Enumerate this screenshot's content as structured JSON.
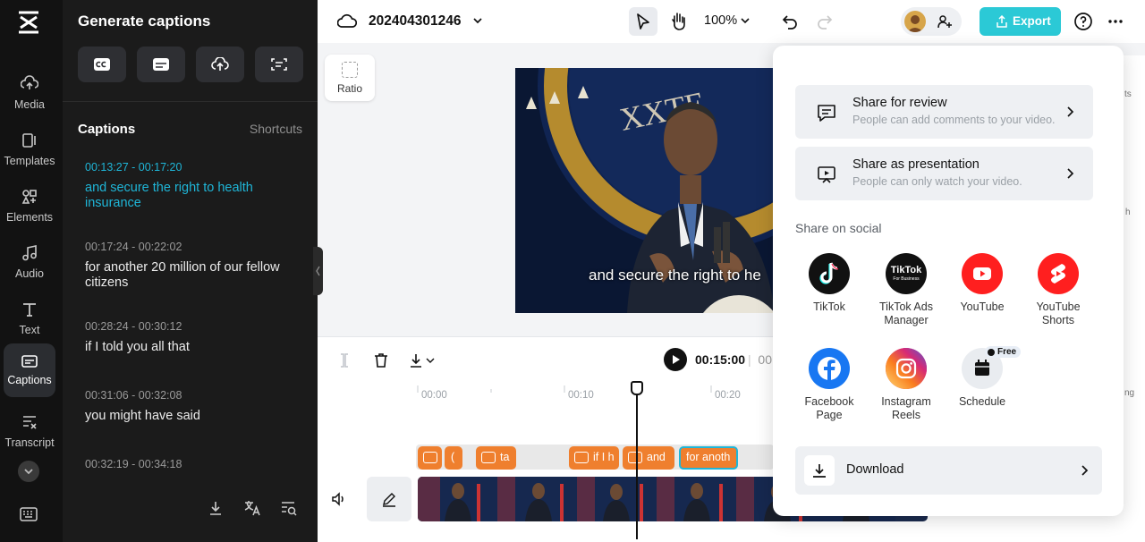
{
  "rail": {
    "items": [
      {
        "label": "Media",
        "icon": "media-icon"
      },
      {
        "label": "Templates",
        "icon": "templates-icon"
      },
      {
        "label": "Elements",
        "icon": "elements-icon"
      },
      {
        "label": "Audio",
        "icon": "audio-icon"
      },
      {
        "label": "Text",
        "icon": "text-icon"
      },
      {
        "label": "Captions",
        "icon": "captions-icon",
        "active": true
      },
      {
        "label": "Transcript",
        "icon": "transcript-icon"
      }
    ]
  },
  "panel": {
    "title": "Generate captions",
    "captions_heading": "Captions",
    "shortcuts_label": "Shortcuts",
    "captions": [
      {
        "time": "00:13:27 - 00:17:20",
        "text": "and secure the right to health insurance",
        "active": true
      },
      {
        "time": "00:17:24 - 00:22:02",
        "text": "for another 20 million of our fellow citizens"
      },
      {
        "time": "00:28:24 - 00:30:12",
        "text": "if I told you all that"
      },
      {
        "time": "00:31:06 - 00:32:08",
        "text": "you might have said"
      },
      {
        "time": "00:32:19 - 00:34:18",
        "text": ""
      }
    ]
  },
  "topbar": {
    "project_name": "202404301246",
    "zoom": "100%",
    "export_label": "Export"
  },
  "canvas": {
    "ratio_label": "Ratio",
    "subtitle": "and secure the right to he"
  },
  "timeline": {
    "current_time": "00:15:00",
    "total_time_partial": "00:",
    "ruler": [
      "00:00",
      "00:10",
      "00:20"
    ],
    "clips": [
      {
        "label": ""
      },
      {
        "label": "("
      },
      {
        "label": "ta"
      },
      {
        "label": "if I h"
      },
      {
        "label": "and"
      },
      {
        "label": "for anoth"
      }
    ]
  },
  "share": {
    "review_title": "Share for review",
    "review_sub": "People can add comments to your video.",
    "presentation_title": "Share as presentation",
    "presentation_sub": "People can only watch your video.",
    "social_heading": "Share on social",
    "social": [
      {
        "label": "TikTok",
        "color": "#111111"
      },
      {
        "label": "TikTok Ads Manager",
        "color": "#111111"
      },
      {
        "label": "YouTube",
        "color": "#ff1f1f"
      },
      {
        "label": "YouTube Shorts",
        "color": "#ff1f1f"
      },
      {
        "label": "Facebook Page",
        "color": "#1877f2"
      },
      {
        "label": "Instagram Reels",
        "color": "#d62976"
      },
      {
        "label": "Schedule",
        "color": "#e9ecf0"
      }
    ],
    "tiktok_ads_logo": "TikTok",
    "tiktok_ads_sub": "For Business",
    "free_badge": "Free",
    "download_label": "Download"
  },
  "edge": {
    "t1": "ts",
    "t2": "h",
    "t3": "ng"
  },
  "colors": {
    "accent": "#2bc9d6",
    "caption_active": "#1fb6d8",
    "clip": "#ef7f2e"
  }
}
